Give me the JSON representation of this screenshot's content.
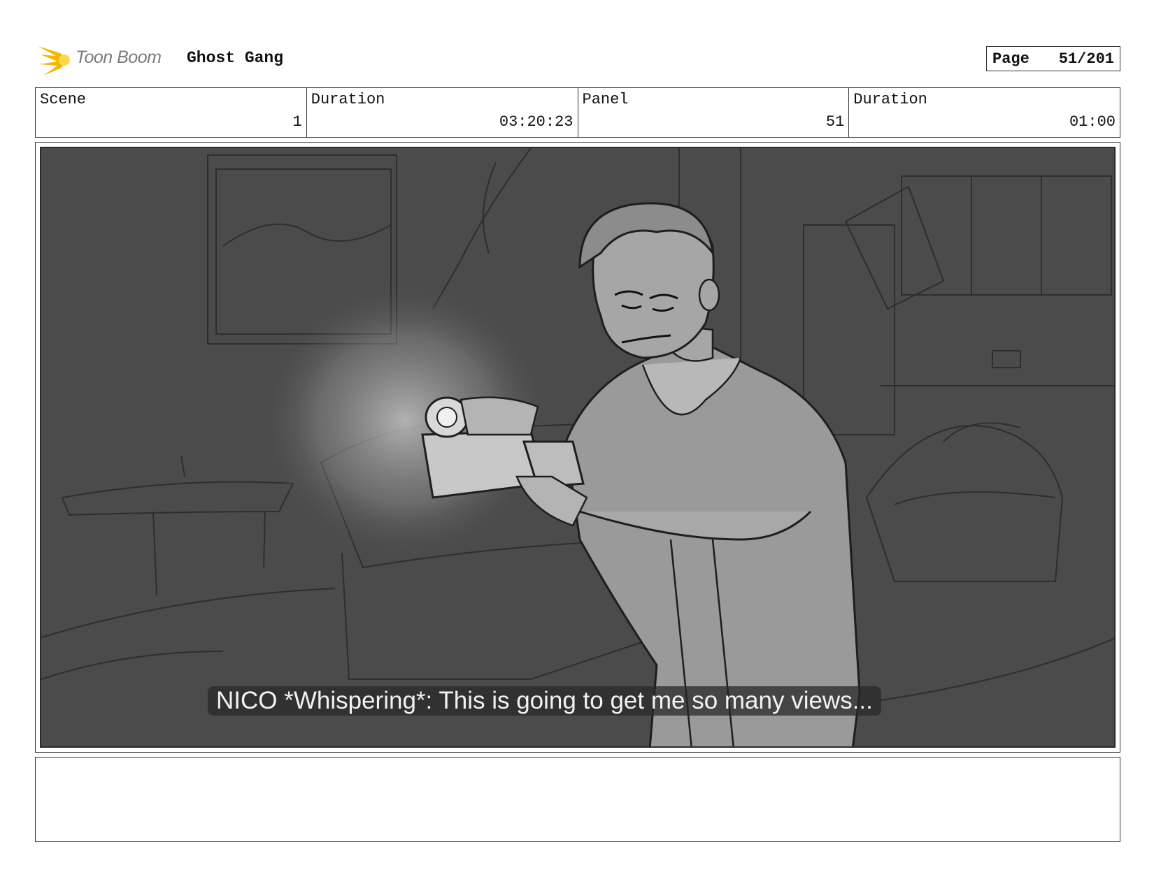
{
  "header": {
    "logo_text": "Toon Boom",
    "project_title": "Ghost Gang",
    "page_label": "Page",
    "page_number": "51/201"
  },
  "info": {
    "scene_label": "Scene",
    "scene_value": "1",
    "duration_label": "Duration",
    "duration_value": "03:20:23",
    "panel_label": "Panel",
    "panel_value": "51",
    "panel_duration_label": "Duration",
    "panel_duration_value": "01:00"
  },
  "panel": {
    "caption": "NICO *Whispering*: This is going to get me so many views..."
  },
  "notes": {
    "text": ""
  },
  "colors": {
    "logo_accent": "#f5b800",
    "panel_background": "#4b4b4b"
  }
}
